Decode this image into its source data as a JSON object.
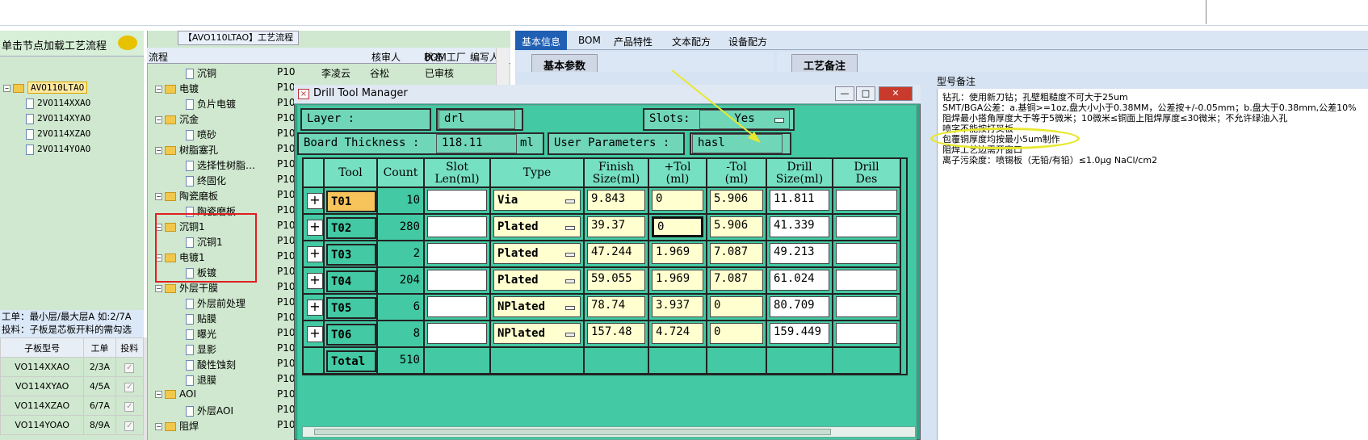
{
  "left_panel": {
    "header": "单击节点加载工艺流程",
    "tree_root": "AVO110LTAO",
    "tree_children": [
      "2VO114XXAO",
      "2VO114XYAO",
      "2VO114XZAO",
      "2VO114YOAO"
    ],
    "note_line1": "工单：最小层/最大层A 如:2/7A",
    "note_line2": "投料：子板是芯板开料的需勾选",
    "table_headers": [
      "子板型号",
      "工单",
      "投料"
    ],
    "table_rows": [
      {
        "model": "VO114XXAO",
        "order": "2/3A",
        "check": "✓"
      },
      {
        "model": "VO114XYAO",
        "order": "4/5A",
        "check": "✓"
      },
      {
        "model": "VO114XZAO",
        "order": "6/7A",
        "check": "✓"
      },
      {
        "model": "VO114YOAO",
        "order": "8/9A",
        "check": "✓"
      }
    ]
  },
  "mid_panel": {
    "title": "【AVO110LTAO】工艺流程",
    "headers": [
      "流程",
      "BOM工厂",
      "编写人",
      "核审人",
      "状态"
    ],
    "first_row": {
      "name": "沉铜",
      "bom": "P10",
      "writer": "李凌云",
      "reviewer": "谷松",
      "status": "已审核"
    },
    "rows": [
      {
        "name": "电镀",
        "bom": "P10",
        "type": "folder"
      },
      {
        "name": "负片电镀",
        "bom": "P10",
        "type": "doc"
      },
      {
        "name": "沉金",
        "bom": "P10",
        "type": "folder"
      },
      {
        "name": "喷砂",
        "bom": "P10",
        "type": "doc"
      },
      {
        "name": "树脂塞孔",
        "bom": "P10",
        "type": "folder"
      },
      {
        "name": "选择性树脂…",
        "bom": "P10",
        "type": "doc"
      },
      {
        "name": "终固化",
        "bom": "P10",
        "type": "doc"
      },
      {
        "name": "陶瓷磨板",
        "bom": "P10",
        "type": "folder"
      },
      {
        "name": "陶瓷磨板",
        "bom": "P10",
        "type": "doc"
      },
      {
        "name": "沉铜1",
        "bom": "P10",
        "type": "folder"
      },
      {
        "name": "沉铜1",
        "bom": "P10",
        "type": "doc"
      },
      {
        "name": "电镀1",
        "bom": "P10",
        "type": "folder"
      },
      {
        "name": "板镀",
        "bom": "P10",
        "type": "doc"
      },
      {
        "name": "外层干膜",
        "bom": "P10",
        "type": "folder"
      },
      {
        "name": "外层前处理",
        "bom": "P10",
        "type": "doc"
      },
      {
        "name": "贴膜",
        "bom": "P10",
        "type": "doc"
      },
      {
        "name": "曝光",
        "bom": "P10",
        "type": "doc"
      },
      {
        "name": "显影",
        "bom": "P10",
        "type": "doc"
      },
      {
        "name": "酸性蚀刻",
        "bom": "P10",
        "type": "doc"
      },
      {
        "name": "退膜",
        "bom": "P10",
        "type": "doc"
      },
      {
        "name": "AOI",
        "bom": "P10",
        "type": "folder"
      },
      {
        "name": "外层AOI",
        "bom": "P10",
        "type": "doc"
      },
      {
        "name": "阻焊",
        "bom": "P10",
        "type": "folder"
      }
    ]
  },
  "right_panel": {
    "tabs": [
      "基本信息",
      "BOM",
      "产品特性",
      "文本配方",
      "设备配方"
    ],
    "subtab_left": "基本参数",
    "subtab_right": "工艺备注",
    "notes_label": "型号备注",
    "notes_lines": [
      "钻孔：使用新刀钻；孔壁粗糙度不可大于25um",
      "SMT/BGA公差：a.基铜>=1oz,盘大小小于0.38MM，公差按+/-0.05mm；b.盘大于0.38mm,公差10%",
      "阻焊最小搭角厚度大于等于5微米；10微米≤铜面上阻焊厚度≤30微米；不允许绿油入孔",
      "喷字不能按打叉板",
      "包覆铜厚度均按最小5um制作",
      "阻焊工艺边需开窗口",
      "离子污染度：喷锡板（无铅/有铅）≤1.0μg NaCl/cm2"
    ]
  },
  "dialog": {
    "title": "Drill Tool Manager",
    "buttons": {
      "minimize": "—",
      "maximize": "□",
      "close": "✕"
    },
    "layer_label": "Layer        :",
    "layer_value": "drl",
    "slots_label": "Slots:",
    "slots_value": "Yes",
    "board_thickness_label": "Board Thickness :",
    "board_thickness_value": "118.11",
    "board_thickness_unit": "ml",
    "user_params_label": "User Parameters :",
    "user_params_value": "hasl",
    "columns": [
      "",
      "Tool",
      "Count",
      "Slot\nLen(ml)",
      "Type",
      "Finish\nSize(ml)",
      "+Tol\n(ml)",
      "-Tol\n(ml)",
      "Drill\nSize(ml)",
      "Drill\nDes"
    ],
    "rows": [
      {
        "tool": "T01",
        "count": "10",
        "slot": "",
        "type": "Via",
        "finish": "9.843",
        "ptol": "0",
        "ntol": "5.906",
        "drill": "11.811",
        "des": ""
      },
      {
        "tool": "T02",
        "count": "280",
        "slot": "",
        "type": "Plated",
        "finish": "39.37",
        "ptol": "0",
        "ntol": "5.906",
        "drill": "41.339",
        "des": ""
      },
      {
        "tool": "T03",
        "count": "2",
        "slot": "",
        "type": "Plated",
        "finish": "47.244",
        "ptol": "1.969",
        "ntol": "7.087",
        "drill": "49.213",
        "des": ""
      },
      {
        "tool": "T04",
        "count": "204",
        "slot": "",
        "type": "Plated",
        "finish": "59.055",
        "ptol": "1.969",
        "ntol": "7.087",
        "drill": "61.024",
        "des": ""
      },
      {
        "tool": "T05",
        "count": "6",
        "slot": "",
        "type": "NPlated",
        "finish": "78.74",
        "ptol": "3.937",
        "ntol": "0",
        "drill": "80.709",
        "des": ""
      },
      {
        "tool": "T06",
        "count": "8",
        "slot": "",
        "type": "NPlated",
        "finish": "157.48",
        "ptol": "4.724",
        "ntol": "0",
        "drill": "159.449",
        "des": ""
      }
    ],
    "total_label": "Total",
    "total_value": "510"
  },
  "colors": {
    "dialog_bg": "#43c9a3",
    "highlight": "#f7c35b",
    "accent_tab": "#1f5fb4",
    "annotation_red": "#e02020",
    "annotation_yellow": "#e8e830"
  }
}
